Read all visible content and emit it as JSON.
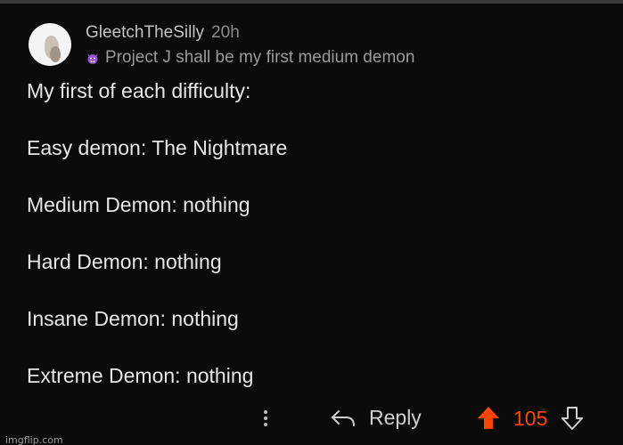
{
  "comment": {
    "username": "GleetchTheSilly",
    "timestamp": "20h",
    "flair": {
      "icon": "devil-emoji-icon",
      "text": "Project J shall be my first medium demon"
    },
    "body_lines": [
      "My first of each difficulty:",
      "Easy demon: The Nightmare",
      "Medium Demon: nothing",
      "Hard Demon: nothing",
      "Insane Demon: nothing",
      "Extreme Demon: nothing"
    ]
  },
  "actions": {
    "more_icon": "more-vertical-icon",
    "reply_label": "Reply",
    "score": "105",
    "upvote_state": "active",
    "colors": {
      "upvote": "#ff4500",
      "text": "#cfcfcf",
      "background": "#0b0b0b"
    }
  },
  "watermark": "imgflip.com"
}
